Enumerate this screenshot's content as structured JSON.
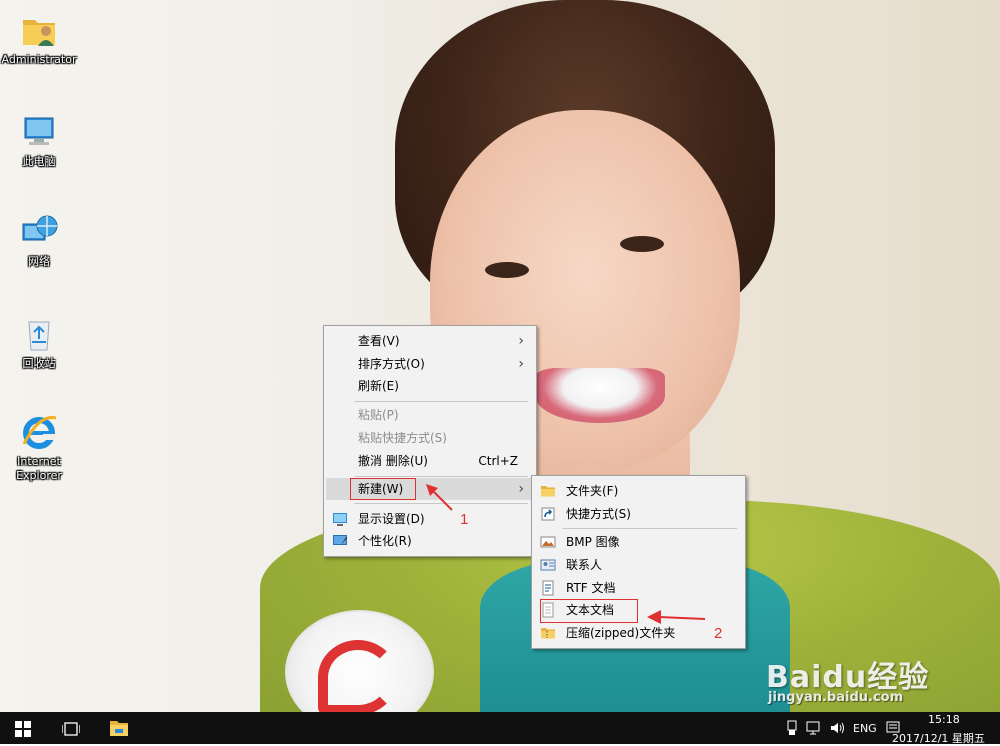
{
  "desktop_icons": [
    {
      "label": "Administrator",
      "icon": "user-folder-icon"
    },
    {
      "label": "此电脑",
      "icon": "computer-icon"
    },
    {
      "label": "网络",
      "icon": "network-icon"
    },
    {
      "label": "回收站",
      "icon": "recycle-bin-icon"
    },
    {
      "label": "Internet Explorer",
      "icon": "internet-explorer-icon"
    }
  ],
  "context_menu": {
    "items": [
      {
        "label": "查看(V)",
        "submenu": true
      },
      {
        "label": "排序方式(O)",
        "submenu": true
      },
      {
        "label": "刷新(E)"
      },
      {
        "label": "粘贴(P)",
        "disabled": true
      },
      {
        "label": "粘贴快捷方式(S)",
        "disabled": true
      },
      {
        "label": "撤消 删除(U)",
        "shortcut": "Ctrl+Z"
      },
      {
        "label": "新建(W)",
        "submenu": true,
        "highlighted": true
      },
      {
        "label": "显示设置(D)",
        "icon": "display-settings-icon"
      },
      {
        "label": "个性化(R)",
        "icon": "personalize-icon"
      }
    ]
  },
  "new_submenu": {
    "items": [
      {
        "label": "文件夹(F)",
        "icon": "folder-icon"
      },
      {
        "label": "快捷方式(S)",
        "icon": "shortcut-icon"
      },
      {
        "label": "BMP 图像",
        "icon": "bmp-image-icon"
      },
      {
        "label": "联系人",
        "icon": "contact-icon"
      },
      {
        "label": "RTF 文档",
        "icon": "rtf-document-icon"
      },
      {
        "label": "文本文档",
        "icon": "text-document-icon"
      },
      {
        "label": "压缩(zipped)文件夹",
        "icon": "zip-folder-icon"
      }
    ]
  },
  "annotations": {
    "step1": "1",
    "step2": "2"
  },
  "taskbar": {
    "start_icon": "windows-start-icon",
    "task_view_icon": "task-view-icon",
    "explorer_icon": "file-explorer-icon",
    "tray": {
      "language": "ENG",
      "time": "15:18",
      "date": "2017/12/1 星期五"
    }
  },
  "watermark": {
    "title": "Baidu经验",
    "url": "jingyan.baidu.com"
  },
  "colors": {
    "annotation_red": "#e03030",
    "menu_bg": "#f2f2f2",
    "highlight": "#dadada",
    "taskbar": "#101010"
  }
}
